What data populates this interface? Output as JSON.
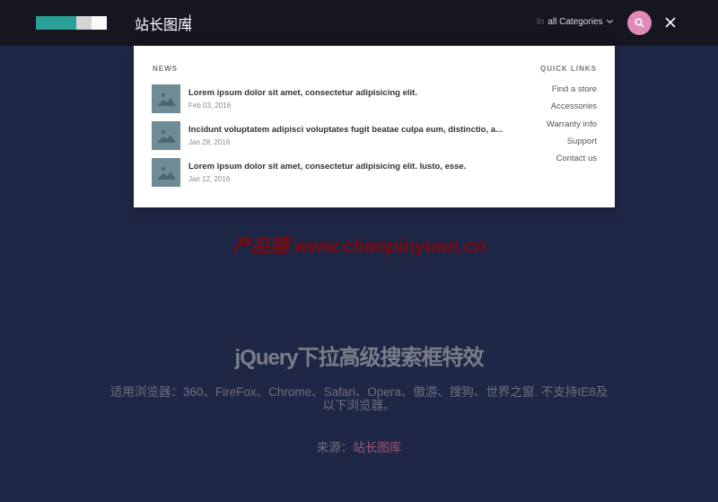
{
  "header": {
    "search_value": "站长图库",
    "category_prefix": "In",
    "category_value": "all Categories",
    "colors": {
      "accent_teal": "#2aa198",
      "search_button": "#e08ab8"
    }
  },
  "dropdown": {
    "news_heading": "NEWS",
    "news": [
      {
        "title": "Lorem ipsum dolor sit amet, consectetur adipisicing elit.",
        "date": "Feb 03, 2016"
      },
      {
        "title": "Incidunt voluptatem adipisci voluptates fugit beatae culpa eum, distinctio, a...",
        "date": "Jan 28, 2016"
      },
      {
        "title": "Lorem ipsum dolor sit amet, consectetur adipisicing elit. Iusto, esse.",
        "date": "Jan 12, 2016"
      }
    ],
    "quick_links_heading": "QUICK LINKS",
    "quick_links": [
      "Find a store",
      "Accessories",
      "Warranty info",
      "Support",
      "Contact us"
    ]
  },
  "watermark": "产品猿 www.chanpinyuan.cn",
  "main": {
    "title": "jQuery下拉高级搜索框特效",
    "description": "适用浏览器：360、FireFox、Chrome、Safari、Opera、傲游、搜狗、世界之窗. 不支持IE8及以下浏览器。",
    "source_label": "来源：",
    "source_link": "站长图库"
  }
}
